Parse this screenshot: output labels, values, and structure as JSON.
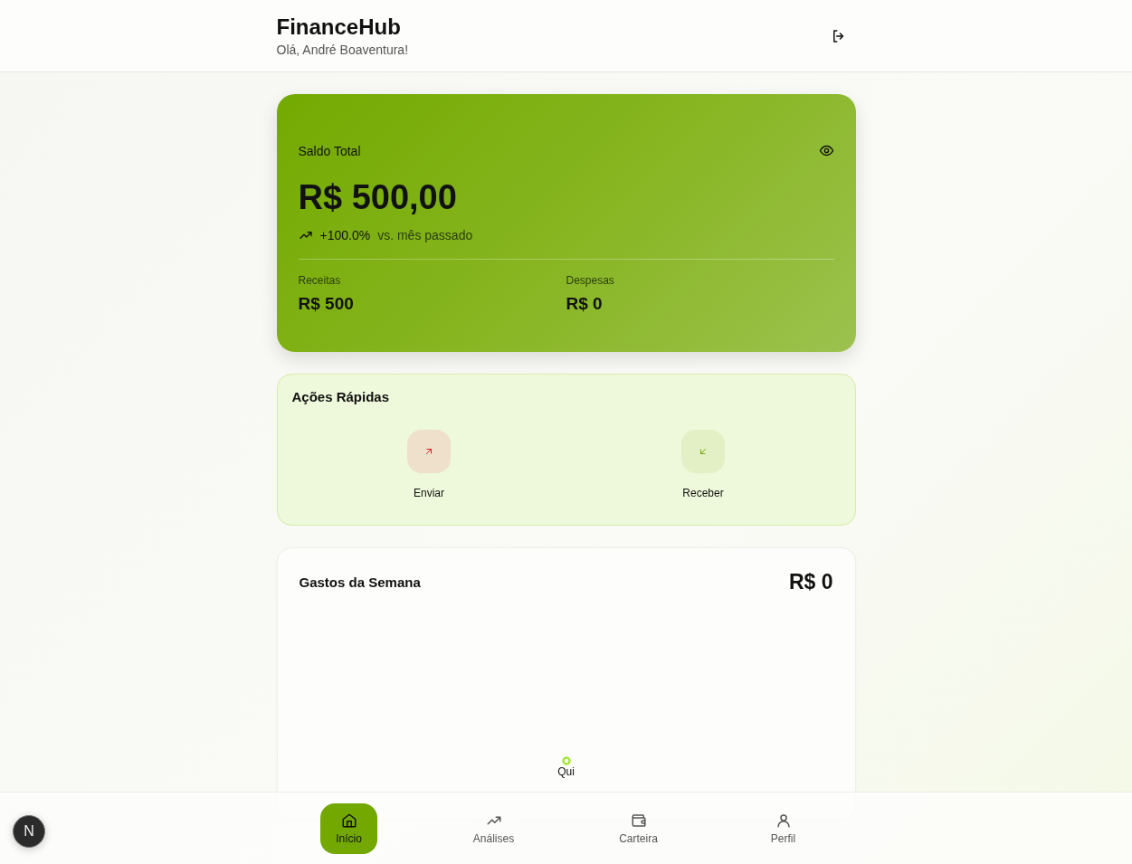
{
  "header": {
    "title": "FinanceHub",
    "greeting": "Olá, André Boaventura!"
  },
  "balance": {
    "label": "Saldo Total",
    "amount": "R$ 500,00",
    "change": "+100.0%",
    "change_note": "vs. mês passado",
    "stats": [
      {
        "label": "Receitas",
        "value": "R$ 500"
      },
      {
        "label": "Despesas",
        "value": "R$ 0"
      }
    ]
  },
  "quick_actions": {
    "title": "Ações Rápidas",
    "actions": [
      {
        "label": "Enviar",
        "kind": "send"
      },
      {
        "label": "Receber",
        "kind": "receive"
      }
    ]
  },
  "weekly_spending": {
    "title": "Gastos da Semana",
    "total": "R$ 0",
    "day_label": "Qui"
  },
  "nav": [
    {
      "label": "Início",
      "kind": "home",
      "selected": true
    },
    {
      "label": "Análises",
      "kind": "analytics",
      "selected": false
    },
    {
      "label": "Carteira",
      "kind": "wallet",
      "selected": false
    },
    {
      "label": "Perfil",
      "kind": "profile",
      "selected": false
    }
  ],
  "dev_badge": {
    "letter": "N"
  }
}
